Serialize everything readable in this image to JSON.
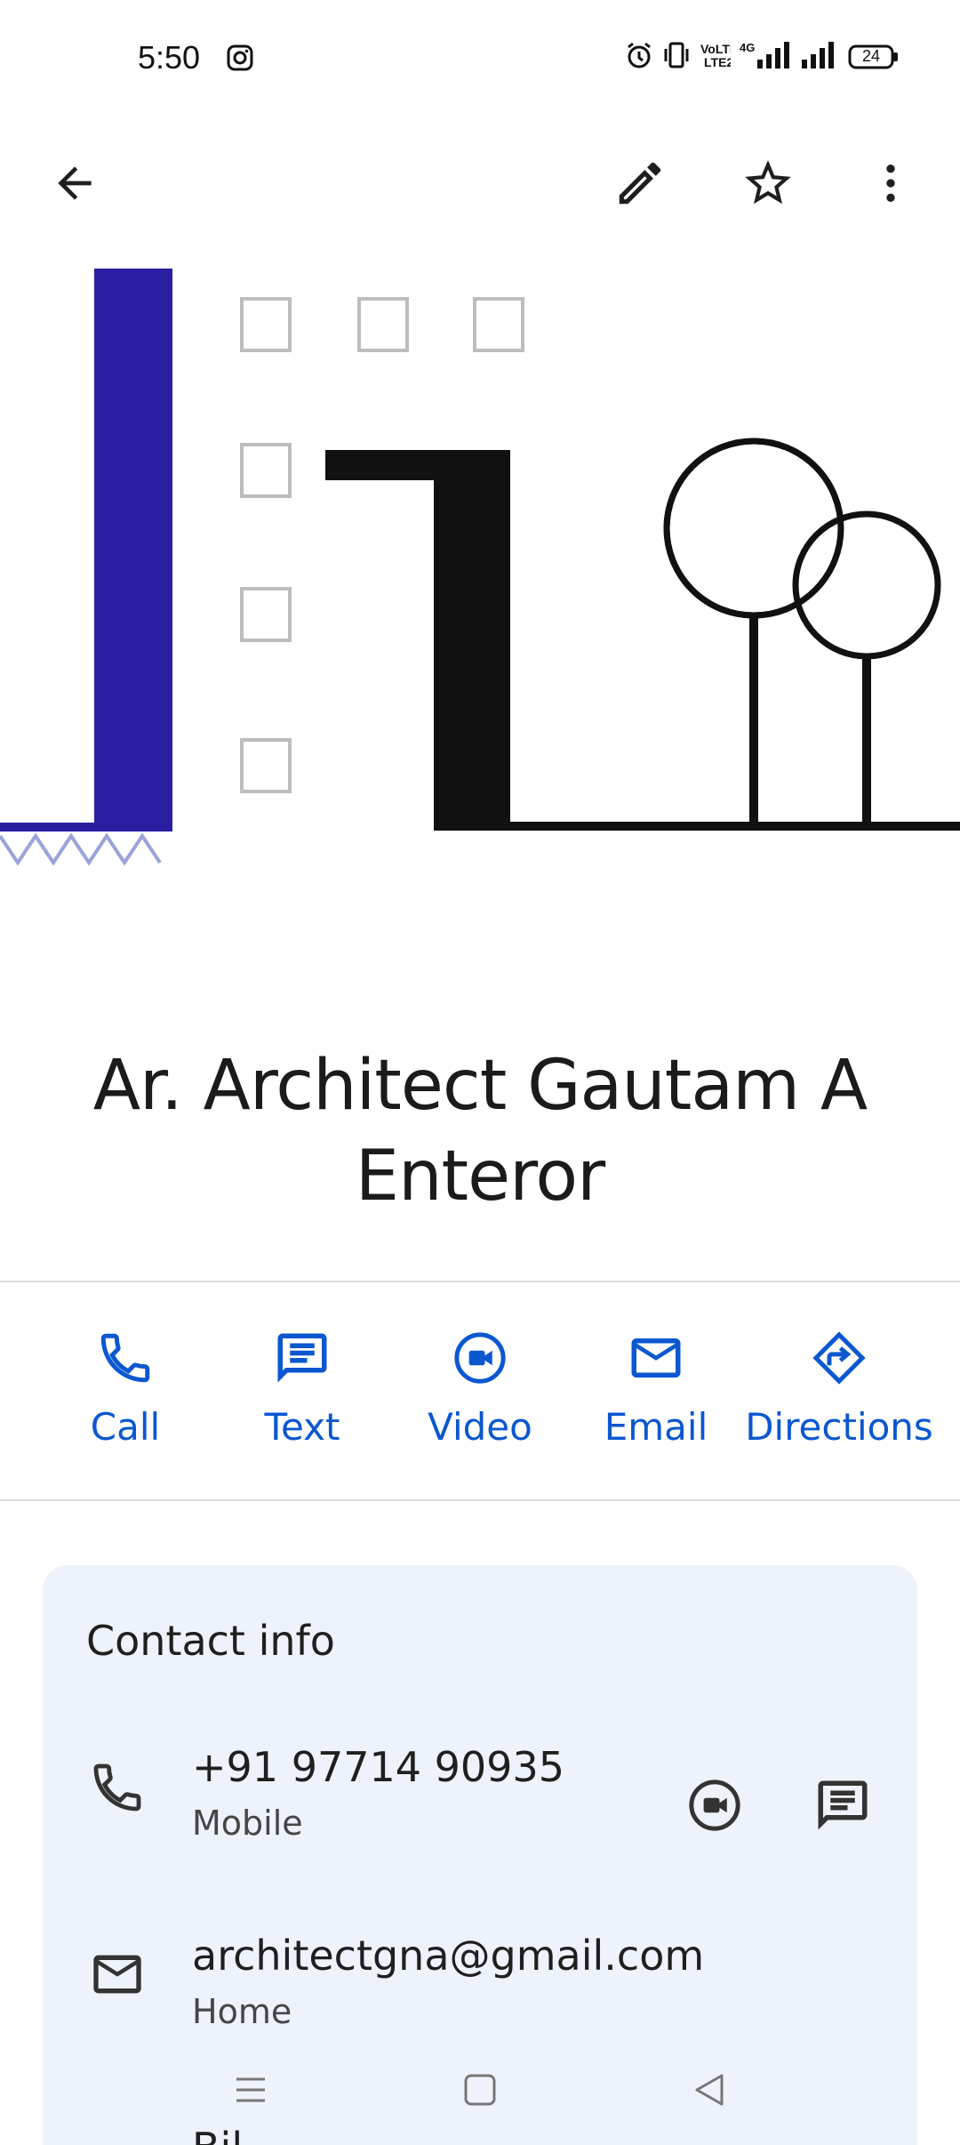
{
  "status": {
    "time": "5:50",
    "battery": "24",
    "icons": [
      "instagram-icon",
      "alarm-icon",
      "vibrate-icon",
      "volte-icon",
      "signal-4g-icon",
      "signal-icon",
      "battery-icon"
    ]
  },
  "toolbar": {
    "back": "back-arrow-icon",
    "edit": "edit-pencil-icon",
    "favorite": "star-outline-icon",
    "more": "more-vert-icon"
  },
  "contact": {
    "name": "Ar. Architect Gautam A Enteror"
  },
  "actions": [
    {
      "label": "Call",
      "icon": "phone-icon"
    },
    {
      "label": "Text",
      "icon": "message-icon"
    },
    {
      "label": "Video",
      "icon": "video-call-icon"
    },
    {
      "label": "Email",
      "icon": "email-icon"
    },
    {
      "label": "Directions",
      "icon": "directions-icon"
    }
  ],
  "contact_info": {
    "title": "Contact info",
    "phone": {
      "value": "+91 97714 90935",
      "type": "Mobile"
    },
    "email": {
      "value": "architectgna@gmail.com",
      "type": "Home"
    },
    "partial_row": "Bil"
  },
  "colors": {
    "accent": "#0b57d0",
    "card_bg": "#eef2fa",
    "hero_blue": "#2b1ea3"
  },
  "navbar": [
    "menu-icon",
    "home-square-icon",
    "back-triangle-icon"
  ]
}
